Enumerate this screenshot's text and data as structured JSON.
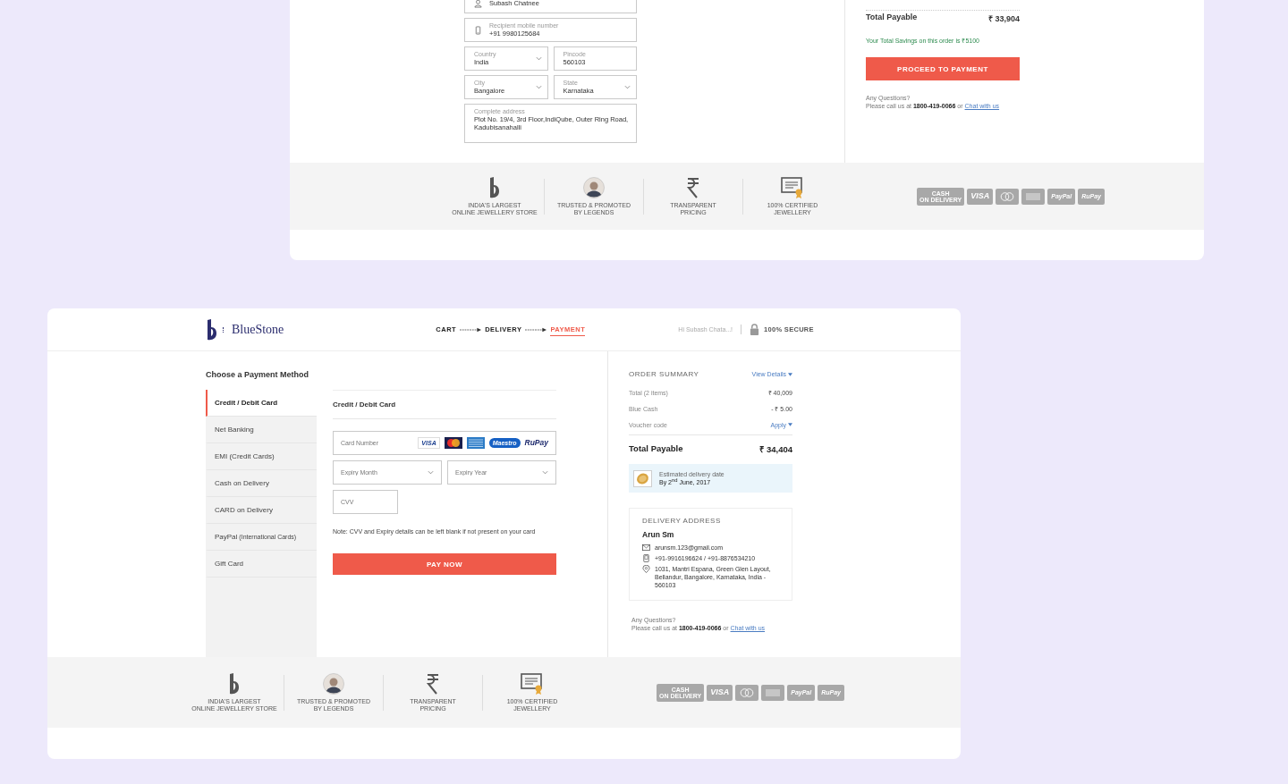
{
  "delivery_screen": {
    "address_form": [
      {
        "kind": "person",
        "value": "Subash Chatnee"
      },
      {
        "kind": "phone",
        "label": "Recipient mobile number",
        "value": "+91 9980125684"
      },
      {
        "kind": "select",
        "label": "Country",
        "value": "India"
      },
      {
        "kind": "text",
        "label": "Pincode",
        "value": "560103"
      },
      {
        "kind": "select",
        "label": "City",
        "value": "Bangalore"
      },
      {
        "kind": "select",
        "label": "State",
        "value": "Karnataka"
      },
      {
        "kind": "address",
        "label": "Complete address",
        "value": "Plot No. 19/4, 3rd Floor,IndiQube, Outer Ring Road, Kadubisanahalli"
      }
    ],
    "summary": {
      "total_label": "Total Payable",
      "total_value": "₹ 33,904",
      "savings": "Your Total Savings on this order is ₹5100",
      "button": "PROCEED TO PAYMENT",
      "question": "Any Questions?",
      "call": "Please call us at **1800-419-0066** or",
      "link": "Chat with us"
    },
    "footer": {
      "features": [
        {
          "kind": "store",
          "lines": [
            "INDIA'S LARGEST",
            "ONLINE JEWELLERY STORE"
          ]
        },
        {
          "kind": "legend",
          "lines": [
            "TRUSTED & PROMOTED",
            "BY LEGENDS"
          ]
        },
        {
          "kind": "pricing",
          "lines": [
            "TRANSPARENT",
            "PRICING"
          ]
        },
        {
          "kind": "certificate",
          "lines": [
            "100% CERTIFIED",
            "JEWELLERY"
          ]
        }
      ],
      "payment_logos": [
        {
          "kind": "cod",
          "lines": [
            "CASH",
            "ON DELIVERY"
          ]
        },
        {
          "kind": "visa",
          "lines": [
            "VISA"
          ]
        },
        {
          "kind": "mastercard"
        },
        {
          "kind": "amex"
        },
        {
          "kind": "paypal",
          "lines": [
            "PayPal"
          ]
        },
        {
          "kind": "rupay",
          "lines": [
            "RuPay"
          ]
        }
      ]
    }
  },
  "payment_screen": {
    "header": {
      "brand": "BlueStone",
      "steps": [
        {
          "label": "CART",
          "selected": false
        },
        {
          "label": "DELIVERY",
          "selected": false
        },
        {
          "label": "PAYMENT",
          "selected": true
        }
      ],
      "greeting": "Hi Subash Chata...!",
      "secure": "100% SECURE"
    },
    "title": "Choose a Payment Method",
    "payment_methods": [
      {
        "label": "Credit / Debit Card",
        "selected": true
      },
      {
        "label": "Net Banking",
        "selected": false
      },
      {
        "label": "EMI (Credit Cards)",
        "selected": false
      },
      {
        "label": "Cash on Delivery",
        "selected": false
      },
      {
        "label": "CARD on Delivery",
        "selected": false
      },
      {
        "label": "PayPal",
        "note": "(International Cards)",
        "selected": false
      },
      {
        "label": "Gift Card",
        "selected": false
      }
    ],
    "card_form": {
      "heading": "Credit / Debit Card",
      "card_number": {
        "placeholder": "Card Number"
      },
      "card_logos": [
        {
          "kind": "visa",
          "text": "VISA"
        },
        {
          "kind": "mastercard"
        },
        {
          "kind": "amex"
        },
        {
          "kind": "maestro",
          "text": "Maestro"
        },
        {
          "kind": "rupay",
          "text": "RuPay"
        }
      ],
      "expiry_month": {
        "placeholder": "Expiry Month"
      },
      "expiry_year": {
        "placeholder": "Expiry Year"
      },
      "cvv": {
        "placeholder": "CVV"
      },
      "note": "Note: CVV and Expiry details can be left blank if not present on your card",
      "button": "PAY NOW"
    },
    "order_summary": {
      "title": "ORDER SUMMARY",
      "view_details": "View Details",
      "rows": [
        {
          "label": "Total (2 items)",
          "value": "₹ 40,009"
        },
        {
          "label": "Blue Cash",
          "value": "- ₹ 5.00"
        },
        {
          "label": "Voucher code",
          "action": "Apply"
        }
      ],
      "total_label": "Total Payable",
      "total_value": "₹ 34,404",
      "delivery": {
        "label": "Estimated delivery date",
        "date": "By 2$^{nd}$ June, 2017"
      }
    },
    "delivery_address": {
      "title": "DELIVERY ADDRESS",
      "name": "Arun Sm",
      "lines": [
        {
          "kind": "email",
          "text": "arunsm.123@gmail.com"
        },
        {
          "kind": "phone",
          "text": "+91-9916196624 / +91-8876534210"
        },
        {
          "kind": "location",
          "text": "1031, Mantri Espana, Green Glen Layout, Bellandur, Bangalore, Karnataka, India - 560103"
        }
      ]
    },
    "help": {
      "question": "Any Questions?",
      "call": "Please call us at **1800-419-0066** or",
      "link": "Chat with us"
    },
    "footer": {
      "features": [
        {
          "kind": "store",
          "lines": [
            "INDIA'S LARGEST",
            "ONLINE JEWELLERY STORE"
          ]
        },
        {
          "kind": "legend",
          "lines": [
            "TRUSTED & PROMOTED",
            "BY LEGENDS"
          ]
        },
        {
          "kind": "pricing",
          "lines": [
            "TRANSPARENT",
            "PRICING"
          ]
        },
        {
          "kind": "certificate",
          "lines": [
            "100% CERTIFIED",
            "JEWELLERY"
          ]
        }
      ],
      "payment_logos": [
        {
          "kind": "cod",
          "lines": [
            "CASH",
            "ON DELIVERY"
          ]
        },
        {
          "kind": "visa",
          "lines": [
            "VISA"
          ]
        },
        {
          "kind": "mastercard"
        },
        {
          "kind": "amex"
        },
        {
          "kind": "paypal",
          "lines": [
            "PayPal"
          ]
        },
        {
          "kind": "rupay",
          "lines": [
            "RuPay"
          ]
        }
      ]
    }
  }
}
